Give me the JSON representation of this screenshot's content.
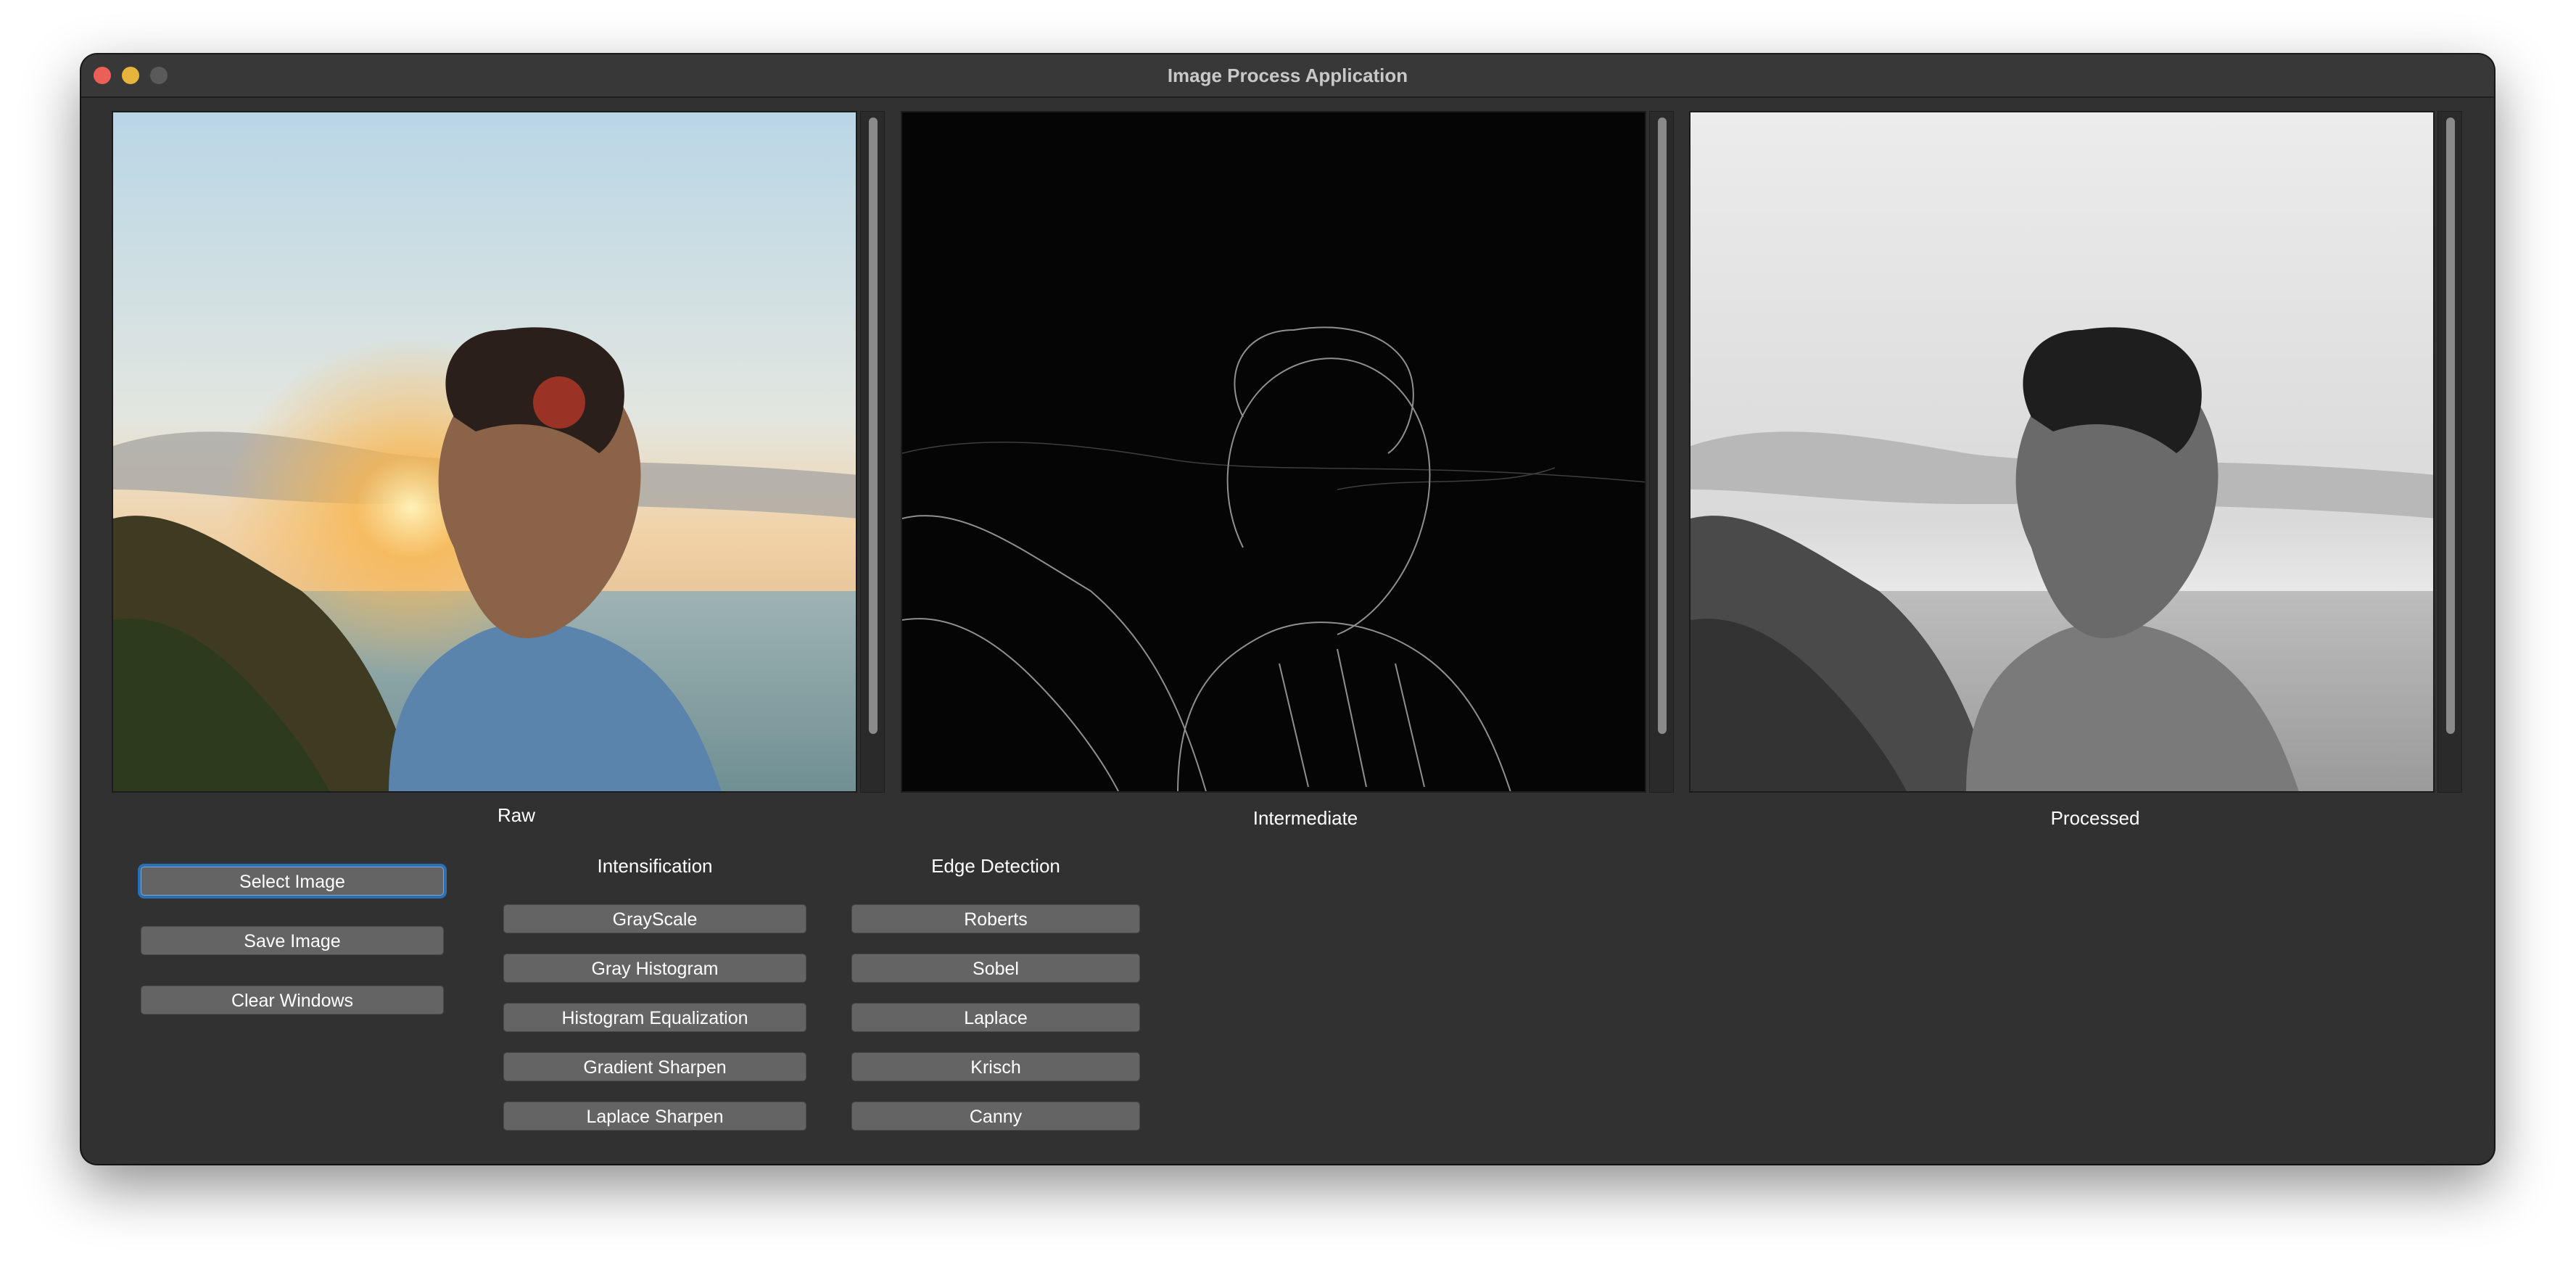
{
  "window": {
    "title": "Image Process Application"
  },
  "panels": [
    {
      "caption": "Raw"
    },
    {
      "caption": "Intermediate"
    },
    {
      "caption": "Processed"
    }
  ],
  "file_buttons": {
    "select": "Select Image",
    "save": "Save Image",
    "clear": "Clear Windows"
  },
  "intensification": {
    "label": "Intensification",
    "buttons": [
      "GrayScale",
      "Gray Histogram",
      "Histogram Equalization",
      "Gradient Sharpen",
      "Laplace Sharpen"
    ]
  },
  "edge_detection": {
    "label": "Edge Detection",
    "buttons": [
      "Roberts",
      "Sobel",
      "Laplace",
      "Krisch",
      "Canny"
    ]
  },
  "colors": {
    "window_bg": "#313131",
    "button_bg": "#646464",
    "focus_ring": "#2c6fb3",
    "close": "#ec5f57",
    "minimize": "#e8b53c"
  }
}
